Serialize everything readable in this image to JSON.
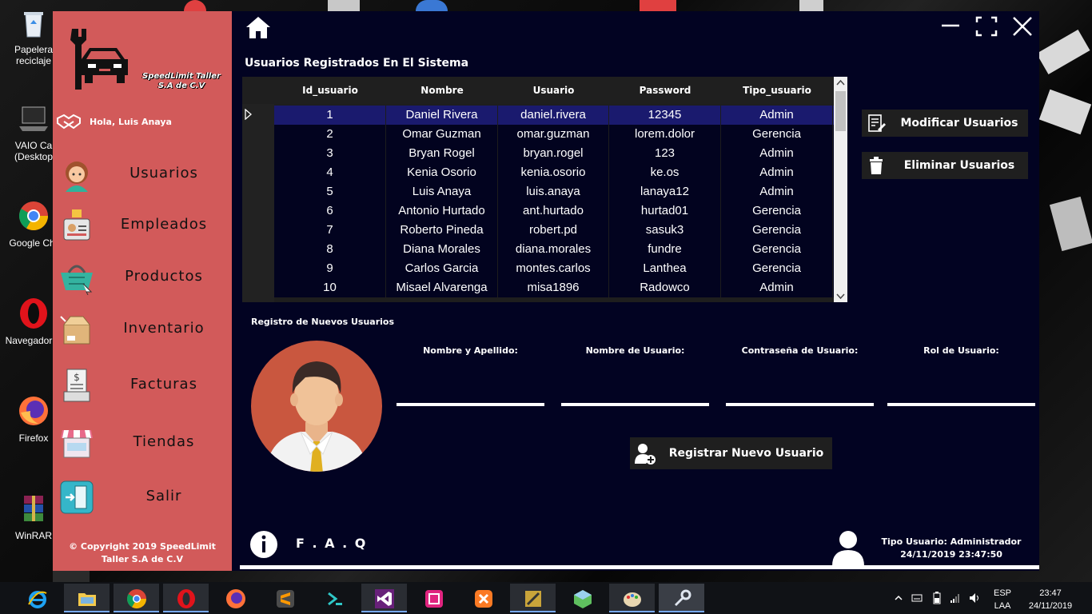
{
  "desktop": {
    "icons": [
      {
        "label": "Papelera de\nreciclaje",
        "short": "Papelera\nreciclaje"
      },
      {
        "label": "VAIO Ca\n(Desktop"
      },
      {
        "label": "Google Chr"
      },
      {
        "label": "Navegador C"
      },
      {
        "label": "Firefox"
      },
      {
        "label": "WinRAR"
      }
    ]
  },
  "sidebar": {
    "brand": {
      "line1": "SpeedLimit Taller",
      "line2": "S.A de C.V"
    },
    "greeting": "Hola, Luis Anaya",
    "items": [
      {
        "label": "Usuarios",
        "icon": "user-avatar-icon"
      },
      {
        "label": "Empleados",
        "icon": "employee-badge-icon"
      },
      {
        "label": "Productos",
        "icon": "shopping-basket-icon"
      },
      {
        "label": "Inventario",
        "icon": "box-icon"
      },
      {
        "label": "Facturas",
        "icon": "invoice-icon"
      },
      {
        "label": "Tiendas",
        "icon": "store-icon"
      },
      {
        "label": "Salir",
        "icon": "exit-door-icon"
      }
    ],
    "copyright": {
      "line1": "© Copyright 2019 SpeedLimit",
      "line2": "Taller S.A de C.V"
    }
  },
  "header": {
    "section_title": "Usuarios Registrados En El Sistema"
  },
  "table": {
    "columns": [
      "Id_usuario",
      "Nombre",
      "Usuario",
      "Password",
      "Tipo_usuario"
    ],
    "rows": [
      [
        "1",
        "Daniel Rivera",
        "daniel.rivera",
        "12345",
        "Admin"
      ],
      [
        "2",
        "Omar Guzman",
        "omar.guzman",
        "lorem.dolor",
        "Gerencia"
      ],
      [
        "3",
        "Bryan Rogel",
        "bryan.rogel",
        "123",
        "Admin"
      ],
      [
        "4",
        "Kenia Osorio",
        "kenia.osorio",
        "ke.os",
        "Admin"
      ],
      [
        "5",
        "Luis Anaya",
        "luis.anaya",
        "lanaya12",
        "Admin"
      ],
      [
        "6",
        "Antonio Hurtado",
        "ant.hurtado",
        "hurtad01",
        "Gerencia"
      ],
      [
        "7",
        "Roberto Pineda",
        "robert.pd",
        "sasuk3",
        "Gerencia"
      ],
      [
        "8",
        "Diana Morales",
        "diana.morales",
        "fundre",
        "Gerencia"
      ],
      [
        "9",
        "Carlos Garcia",
        "montes.carlos",
        "Lanthea",
        "Gerencia"
      ],
      [
        "10",
        "Misael Alvarenga",
        "misa1896",
        "Radowco",
        "Admin"
      ]
    ],
    "selected_row": 0
  },
  "actions": {
    "modify_label": "Modificar Usuarios",
    "delete_label": "Eliminar Usuarios"
  },
  "registration": {
    "title": "Registro de Nuevos Usuarios",
    "fields": [
      {
        "label": "Nombre y Apellido:",
        "value": ""
      },
      {
        "label": "Nombre de Usuario:",
        "value": ""
      },
      {
        "label": "Contraseña de Usuario:",
        "value": ""
      },
      {
        "label": "Rol de Usuario:",
        "value": ""
      }
    ],
    "register_label": "Registrar Nuevo Usuario"
  },
  "footer": {
    "faq_label": "F . A . Q",
    "user_type": "Tipo Usuario: Administrador",
    "datetime": "24/11/2019 23:47:50"
  },
  "taskbar": {
    "language": "ESP",
    "layout": "LAA",
    "time": "23:47",
    "date": "24/11/2019"
  },
  "colors": {
    "sidebar": "#d25a5a",
    "panel": "#020322",
    "selected_row": "#1a1a6e",
    "button": "#1f1f1f"
  }
}
